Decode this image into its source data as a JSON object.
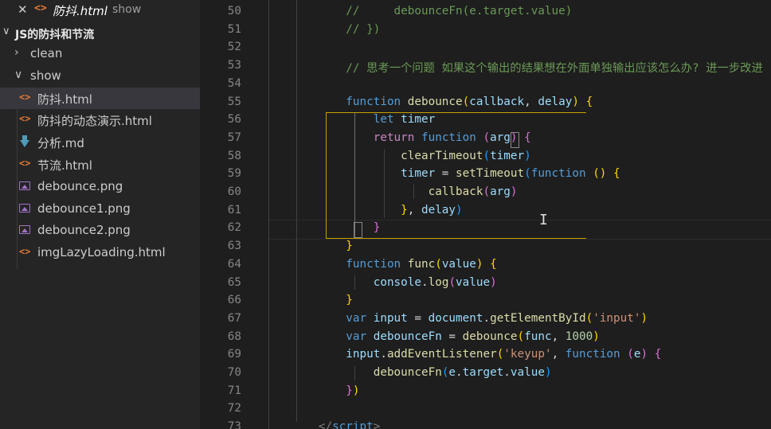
{
  "open_tab": {
    "name": "防抖.html",
    "folder": "show",
    "close_glyph": "✕",
    "file_icon": "<>"
  },
  "project": {
    "name": "JS的防抖和节流",
    "chevron": "∨"
  },
  "tree": [
    {
      "kind": "folder",
      "name": "clean",
      "chevron": "›",
      "expanded": false
    },
    {
      "kind": "folder",
      "name": "show",
      "chevron": "∨",
      "expanded": true
    },
    {
      "kind": "html",
      "name": "防抖.html",
      "selected": true
    },
    {
      "kind": "html",
      "name": "防抖的动态演示.html"
    },
    {
      "kind": "md",
      "name": "分析.md"
    },
    {
      "kind": "html",
      "name": "节流.html"
    },
    {
      "kind": "png",
      "name": "debounce.png"
    },
    {
      "kind": "png",
      "name": "debounce1.png"
    },
    {
      "kind": "png",
      "name": "debounce2.png"
    },
    {
      "kind": "html",
      "name": "imgLazyLoading.html"
    }
  ],
  "colors": {
    "html_icon": "#e37933",
    "md_icon": "#519aba",
    "png_icon": "#a074c4",
    "keyword": "#569cd6",
    "function_name": "#dcdcaa",
    "variable": "#9cdcfe",
    "string": "#ce9178",
    "number": "#b5cea8",
    "comment": "#6a9955",
    "bracket_gold": "#ffd700",
    "bracket_orchid": "#da70d6",
    "bracket_blue": "#179fff"
  },
  "editor": {
    "lines": [
      {
        "n": "50",
        "tokens": [
          [
            "",
            "            "
          ],
          [
            "cmt",
            "//     debounceFn(e.target.value)"
          ]
        ]
      },
      {
        "n": "51",
        "tokens": [
          [
            "",
            "            "
          ],
          [
            "cmt",
            "// })"
          ]
        ]
      },
      {
        "n": "52",
        "tokens": []
      },
      {
        "n": "53",
        "tokens": [
          [
            "",
            "            "
          ],
          [
            "cmt",
            "// 思考一个问题 如果这个输出的结果想在外面单独输出应该怎么办? 进一步改进"
          ]
        ]
      },
      {
        "n": "54",
        "tokens": []
      },
      {
        "n": "55",
        "tokens": [
          [
            "",
            "            "
          ],
          [
            "kw",
            "function "
          ],
          [
            "fn",
            "debounce"
          ],
          [
            "b1",
            "("
          ],
          [
            "var",
            "callback"
          ],
          [
            "pun",
            ", "
          ],
          [
            "var",
            "delay"
          ],
          [
            "b1",
            ")"
          ],
          [
            "pun",
            " "
          ],
          [
            "b1",
            "{"
          ]
        ]
      },
      {
        "n": "56",
        "tokens": [
          [
            "",
            "                "
          ],
          [
            "kw",
            "let "
          ],
          [
            "var",
            "timer"
          ]
        ]
      },
      {
        "n": "57",
        "tokens": [
          [
            "",
            "                "
          ],
          [
            "ctl",
            "return "
          ],
          [
            "kw",
            "function "
          ],
          [
            "b2",
            "("
          ],
          [
            "var",
            "arg"
          ],
          [
            "b2",
            ")"
          ],
          [
            "pun",
            " "
          ],
          [
            "b2",
            "{"
          ]
        ]
      },
      {
        "n": "58",
        "tokens": [
          [
            "",
            "                    "
          ],
          [
            "fn",
            "clearTimeout"
          ],
          [
            "b3",
            "("
          ],
          [
            "var",
            "timer"
          ],
          [
            "b3",
            ")"
          ]
        ]
      },
      {
        "n": "59",
        "tokens": [
          [
            "",
            "                    "
          ],
          [
            "var",
            "timer"
          ],
          [
            "pun",
            " = "
          ],
          [
            "fn",
            "setTimeout"
          ],
          [
            "b3",
            "("
          ],
          [
            "kw",
            "function "
          ],
          [
            "b1",
            "()"
          ],
          [
            "pun",
            " "
          ],
          [
            "b1",
            "{"
          ]
        ]
      },
      {
        "n": "60",
        "tokens": [
          [
            "",
            "                        "
          ],
          [
            "fn",
            "callback"
          ],
          [
            "b2",
            "("
          ],
          [
            "var",
            "arg"
          ],
          [
            "b2",
            ")"
          ]
        ]
      },
      {
        "n": "61",
        "tokens": [
          [
            "",
            "                    "
          ],
          [
            "b1",
            "}"
          ],
          [
            "pun",
            ", "
          ],
          [
            "var",
            "delay"
          ],
          [
            "b3",
            ")"
          ]
        ]
      },
      {
        "n": "62",
        "tokens": [
          [
            "",
            "                "
          ],
          [
            "b2",
            "}"
          ]
        ]
      },
      {
        "n": "63",
        "tokens": [
          [
            "",
            "            "
          ],
          [
            "b1",
            "}"
          ]
        ]
      },
      {
        "n": "64",
        "tokens": [
          [
            "",
            "            "
          ],
          [
            "kw",
            "function "
          ],
          [
            "fn",
            "func"
          ],
          [
            "b1",
            "("
          ],
          [
            "var",
            "value"
          ],
          [
            "b1",
            ")"
          ],
          [
            "pun",
            " "
          ],
          [
            "b1",
            "{"
          ]
        ]
      },
      {
        "n": "65",
        "tokens": [
          [
            "",
            "                "
          ],
          [
            "var",
            "console"
          ],
          [
            "pun",
            "."
          ],
          [
            "fn",
            "log"
          ],
          [
            "b2",
            "("
          ],
          [
            "var",
            "value"
          ],
          [
            "b2",
            ")"
          ]
        ]
      },
      {
        "n": "66",
        "tokens": [
          [
            "",
            "            "
          ],
          [
            "b1",
            "}"
          ]
        ]
      },
      {
        "n": "67",
        "tokens": [
          [
            "",
            "            "
          ],
          [
            "kw",
            "var "
          ],
          [
            "var",
            "input"
          ],
          [
            "pun",
            " = "
          ],
          [
            "var",
            "document"
          ],
          [
            "pun",
            "."
          ],
          [
            "fn",
            "getElementById"
          ],
          [
            "b1",
            "("
          ],
          [
            "str",
            "'input'"
          ],
          [
            "b1",
            ")"
          ]
        ]
      },
      {
        "n": "68",
        "tokens": [
          [
            "",
            "            "
          ],
          [
            "kw",
            "var "
          ],
          [
            "var",
            "debounceFn"
          ],
          [
            "pun",
            " = "
          ],
          [
            "fn",
            "debounce"
          ],
          [
            "b1",
            "("
          ],
          [
            "var",
            "func"
          ],
          [
            "pun",
            ", "
          ],
          [
            "num",
            "1000"
          ],
          [
            "b1",
            ")"
          ]
        ]
      },
      {
        "n": "69",
        "tokens": [
          [
            "",
            "            "
          ],
          [
            "var",
            "input"
          ],
          [
            "pun",
            "."
          ],
          [
            "fn",
            "addEventListener"
          ],
          [
            "b1",
            "("
          ],
          [
            "str",
            "'keyup'"
          ],
          [
            "pun",
            ", "
          ],
          [
            "kw",
            "function "
          ],
          [
            "b2",
            "("
          ],
          [
            "var",
            "e"
          ],
          [
            "b2",
            ")"
          ],
          [
            "pun",
            " "
          ],
          [
            "b2",
            "{"
          ]
        ]
      },
      {
        "n": "70",
        "tokens": [
          [
            "",
            "                "
          ],
          [
            "fn",
            "debounceFn"
          ],
          [
            "b3",
            "("
          ],
          [
            "var",
            "e"
          ],
          [
            "pun",
            "."
          ],
          [
            "var",
            "target"
          ],
          [
            "pun",
            "."
          ],
          [
            "var",
            "value"
          ],
          [
            "b3",
            ")"
          ]
        ]
      },
      {
        "n": "71",
        "tokens": [
          [
            "",
            "            "
          ],
          [
            "b2",
            "}"
          ],
          [
            "b1",
            ")"
          ]
        ]
      },
      {
        "n": "72",
        "tokens": []
      },
      {
        "n": "73",
        "tokens": [
          [
            "",
            "        "
          ],
          [
            "tag",
            "</"
          ],
          [
            "kw",
            "script"
          ],
          [
            "tag",
            ">"
          ]
        ]
      }
    ]
  }
}
